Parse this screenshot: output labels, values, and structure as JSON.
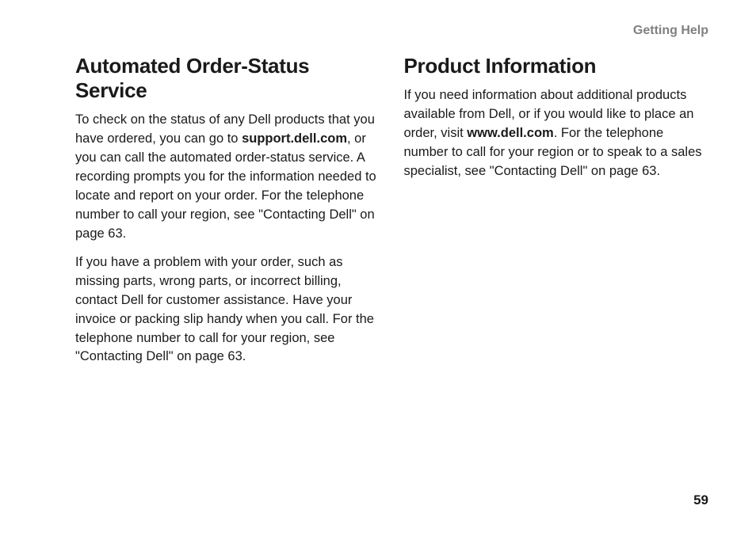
{
  "header": {
    "section": "Getting Help"
  },
  "left": {
    "heading": "Automated Order-Status Service",
    "p1_a": "To check on the status of any Dell products that you have ordered, you can go to ",
    "p1_bold": "support.dell.com",
    "p1_b": ", or you can call the automated order-status service. A recording prompts you for the information needed to locate and report on your order. For the telephone number to call your region, see \"Contacting Dell\" on page 63.",
    "p2": "If you have a problem with your order, such as missing parts, wrong parts, or incorrect billing, contact Dell for customer assistance. Have your invoice or packing slip handy when you call. For the telephone number to call for your region, see \"Contacting Dell\" on page 63."
  },
  "right": {
    "heading": "Product Information",
    "p1_a": "If you need information about additional products available from Dell, or if you would like to place an order, visit ",
    "p1_bold": "www.dell.com",
    "p1_b": ". For the telephone number to call for your region or to speak to a sales specialist, see \"Contacting Dell\" on page 63."
  },
  "pageNumber": "59"
}
